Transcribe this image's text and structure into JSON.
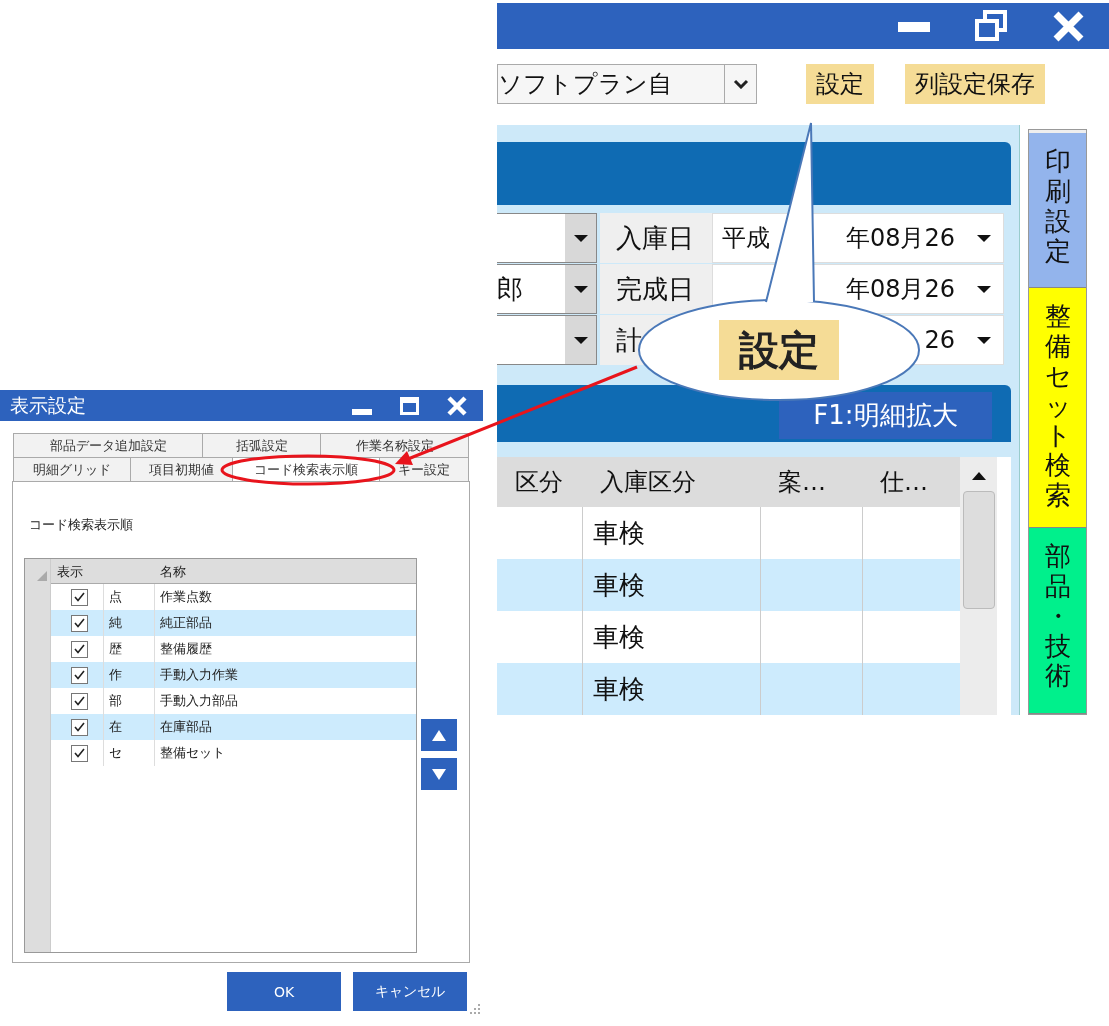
{
  "main_window": {
    "company_select": {
      "value": "ソフトプラン自"
    },
    "toolbar_buttons": [
      "設定",
      "列設定保存"
    ],
    "form_rows": [
      {
        "label": "入庫日",
        "date_parts": [
          "平成",
          "年08月26"
        ]
      },
      {
        "combo_value": "郎",
        "label": "完成日",
        "date_parts": [
          "年08月26"
        ]
      },
      {
        "label": "計",
        "date_parts": [
          "26"
        ]
      }
    ],
    "detail_button": "F1:明細拡大",
    "grid": {
      "columns": [
        "区分",
        "入庫区分",
        "案…",
        "仕…"
      ],
      "rows": [
        {
          "cells": [
            null,
            "車検",
            null,
            null
          ]
        },
        {
          "cells": [
            null,
            "車検",
            null,
            null
          ]
        },
        {
          "cells": [
            null,
            "車検",
            null,
            null
          ]
        },
        {
          "cells": [
            null,
            "車検",
            null,
            null
          ]
        }
      ]
    },
    "side_tabs": [
      {
        "label": "印刷設定",
        "color": "#93b4ec"
      },
      {
        "label": "整備セット検索",
        "color": "#ffff00"
      },
      {
        "label": "部品・技術",
        "color": "#00f08c"
      }
    ]
  },
  "dialog": {
    "title": "表示設定",
    "tab_rows": [
      [
        {
          "label": "部品データ追加設定",
          "selected": false
        },
        {
          "label": "括弧設定",
          "selected": false
        },
        {
          "label": "作業名称設定",
          "selected": false
        }
      ],
      [
        {
          "label": "明細グリッド",
          "selected": false
        },
        {
          "label": "項目初期値",
          "selected": false
        },
        {
          "label": "コード検索表示順",
          "selected": true
        },
        {
          "label": "キー設定",
          "selected": false
        }
      ]
    ],
    "section_label": "コード検索表示順",
    "list": {
      "columns": [
        "表示",
        "名称"
      ],
      "rows": [
        {
          "checked": true,
          "code": "点",
          "name": "作業点数"
        },
        {
          "checked": true,
          "code": "純",
          "name": "純正部品"
        },
        {
          "checked": true,
          "code": "歴",
          "name": "整備履歴"
        },
        {
          "checked": true,
          "code": "作",
          "name": "手動入力作業"
        },
        {
          "checked": true,
          "code": "部",
          "name": "手動入力部品"
        },
        {
          "checked": true,
          "code": "在",
          "name": "在庫部品"
        },
        {
          "checked": true,
          "code": "セ",
          "name": "整備セット"
        }
      ]
    },
    "buttons": [
      "OK",
      "キャンセル"
    ]
  },
  "callout": {
    "label": "設定"
  }
}
